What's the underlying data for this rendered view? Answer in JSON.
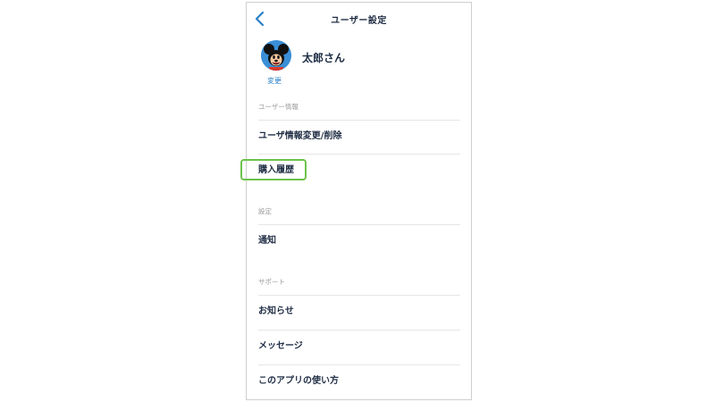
{
  "header": {
    "title": "ユーザー設定",
    "back_icon": "chevron-left-icon",
    "accent_color": "#2a80c8"
  },
  "profile": {
    "name": "太郎さん",
    "change_label": "変更",
    "avatar_icon": "mouse-character-avatar"
  },
  "sections": {
    "user_info": {
      "label": "ユーザー情報",
      "items": [
        "ユーザ情報変更/削除",
        "購入履歴"
      ]
    },
    "settings": {
      "label": "設定",
      "items": [
        "通知"
      ]
    },
    "support": {
      "label": "サポート",
      "items": [
        "お知らせ",
        "メッセージ",
        "このアプリの使い方"
      ]
    }
  },
  "highlight": {
    "target": "購入履歴",
    "color": "#6cc24a"
  }
}
